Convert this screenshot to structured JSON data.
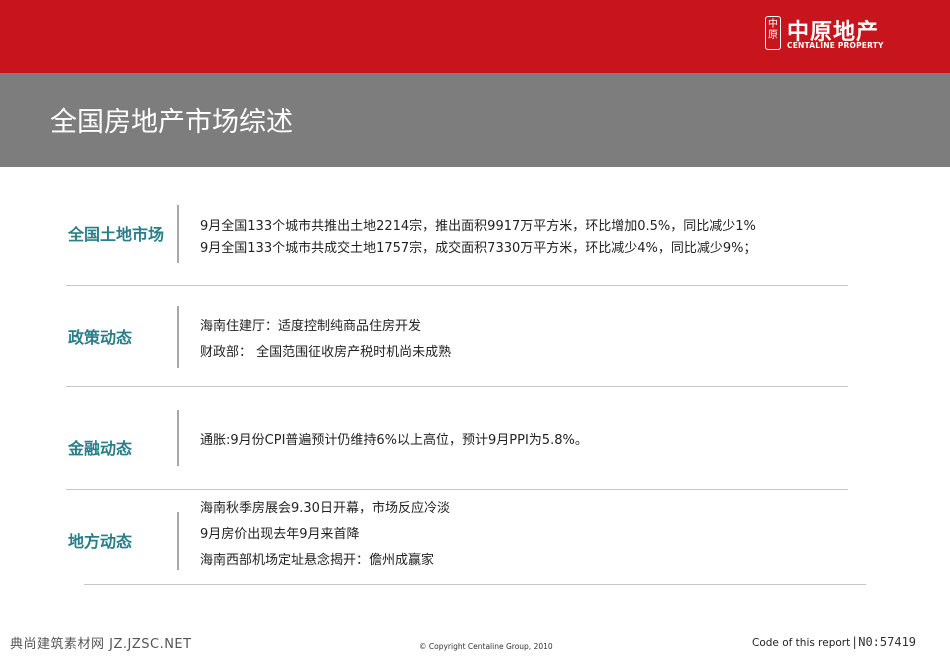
{
  "header": {
    "logo_seal": "中原",
    "logo_cn": "中原地产",
    "logo_en": "CENTALINE PROPERTY"
  },
  "page_title": "全国房地产市场综述",
  "sections": [
    {
      "category": "全国土地市场",
      "lines": [
        "9月全国133个城市共推出土地2214宗，推出面积9917万平方米，环比增加0.5%，同比减少1%",
        "9月全国133个城市共成交土地1757宗，成交面积7330万平方米，环比减少4%，同比减少9%；"
      ]
    },
    {
      "category": "政策动态",
      "lines": [
        "海南住建厅：适度控制纯商品住房开发",
        "财政部：  全国范围征收房产税时机尚未成熟"
      ]
    },
    {
      "category": "金融动态",
      "lines": [
        "通胀:9月份CPI普遍预计仍维持6%以上高位，预计9月PPI为5.8%。"
      ]
    },
    {
      "category": "地方动态",
      "lines": [
        "海南秋季房展会9.30日开幕，市场反应冷淡",
        "9月房价出现去年9月来首降",
        "海南西部机场定址悬念揭开：儋州成赢家"
      ]
    }
  ],
  "footer": {
    "watermark": "典尚建筑素材网 JZ.JZSC.NET",
    "copyright": "© Copyright  Centaline Group, 2010",
    "code_label": "Code of this report",
    "report_number": "|N0:57419"
  },
  "colors": {
    "top_bar": "#c8141c",
    "title_bar": "#7d7d7d",
    "category_text": "#2a7e88"
  }
}
